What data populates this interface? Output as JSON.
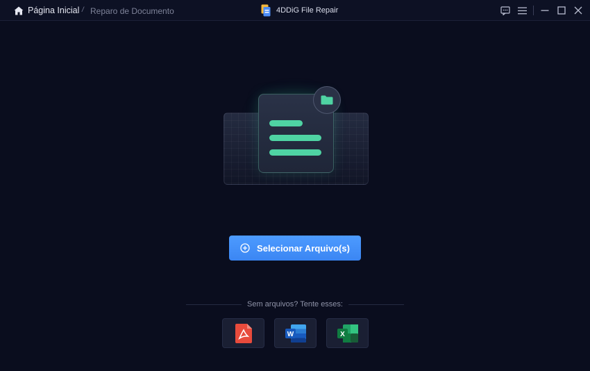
{
  "titlebar": {
    "home_label": "Página Inicial",
    "separator": "/",
    "current_label": "Reparo de Documento",
    "app_title": "4DDiG File Repair"
  },
  "main": {
    "select_button_label": "Selecionar Arquivo(s)",
    "samples_label": "Sem arquivos? Tente esses:",
    "samples": [
      {
        "type": "pdf",
        "icon": "pdf-icon",
        "color": "#e84b3c"
      },
      {
        "type": "word",
        "icon": "word-icon",
        "color": "#2b6fd6",
        "letter": "W"
      },
      {
        "type": "excel",
        "icon": "excel-icon",
        "color": "#1e8c4e",
        "letter": "X"
      }
    ]
  },
  "colors": {
    "accent": "#4d9bff",
    "doc_line": "#4fd3a3",
    "background": "#0a0d1e"
  }
}
